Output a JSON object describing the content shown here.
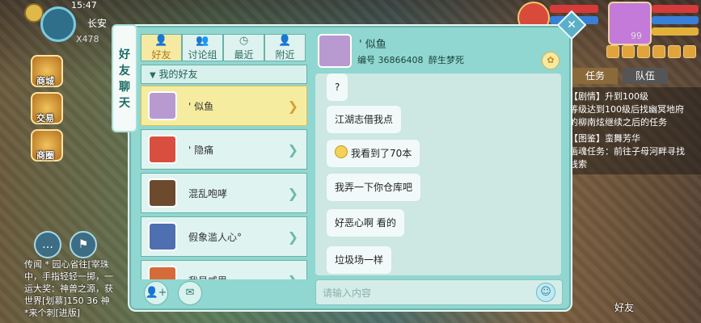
{
  "hud": {
    "clock": "15:47",
    "city": "长安",
    "x_count": "X478",
    "side_buttons": [
      "商城",
      "交易",
      "商圈"
    ],
    "chat_lines": [
      "传闻 * 园心省往[宰珠",
      "中，手指轻轻一掷，一",
      "运大奖：神兽之源，获",
      "世界[划慕]150 36 神",
      "*来个刺[进版]"
    ],
    "level": "99",
    "right_tabs": [
      "任务",
      "队伍"
    ],
    "tasks": [
      {
        "title": "【剧情】升到100级",
        "line1": "等级达到100级后找幽冥地府",
        "line2": "的柳南炫继续之后的任务"
      },
      {
        "title": "【图鉴】蛮舞芳华",
        "line1": "画魂任务：前往子母河畔寻找",
        "line2": "线索"
      }
    ],
    "friend_button": "好友"
  },
  "panel": {
    "ribbon_title": [
      "好",
      "友",
      "聊",
      "天"
    ],
    "close_label": "✕",
    "tabs": [
      {
        "label": "好友",
        "icon": "person-icon",
        "glyph": "👤"
      },
      {
        "label": "讨论组",
        "icon": "group-icon",
        "glyph": "👥"
      },
      {
        "label": "最近",
        "icon": "clock-icon",
        "glyph": "◷"
      },
      {
        "label": "附近",
        "icon": "nearby-icon",
        "glyph": "👤"
      }
    ],
    "group_header": "我的好友",
    "friends": [
      {
        "name": "' 似鱼",
        "color": "#b89ad0",
        "selected": true
      },
      {
        "name": "' 隐痛",
        "color": "#d94f3f",
        "selected": false
      },
      {
        "name": "混乱咆哮",
        "color": "#6b4a2e",
        "selected": false
      },
      {
        "name": "假象滥人心°",
        "color": "#4e6fb0",
        "selected": false
      },
      {
        "name": "我是威思",
        "color": "#d66b3a",
        "selected": false
      }
    ]
  },
  "chat": {
    "name": "' 似鱼",
    "id_label": "编号 36866408",
    "guild": "醉生梦死",
    "messages": [
      {
        "text": "?",
        "emoji": false
      },
      {
        "text": "江湖志借我点",
        "emoji": false
      },
      {
        "text": "我看到了70本",
        "emoji": true
      },
      {
        "text": "我弄一下你仓库吧",
        "emoji": false
      },
      {
        "text": "好恶心啊 看的",
        "emoji": false
      },
      {
        "text": "垃圾场一样",
        "emoji": false
      }
    ],
    "input_placeholder": "请输入内容"
  }
}
